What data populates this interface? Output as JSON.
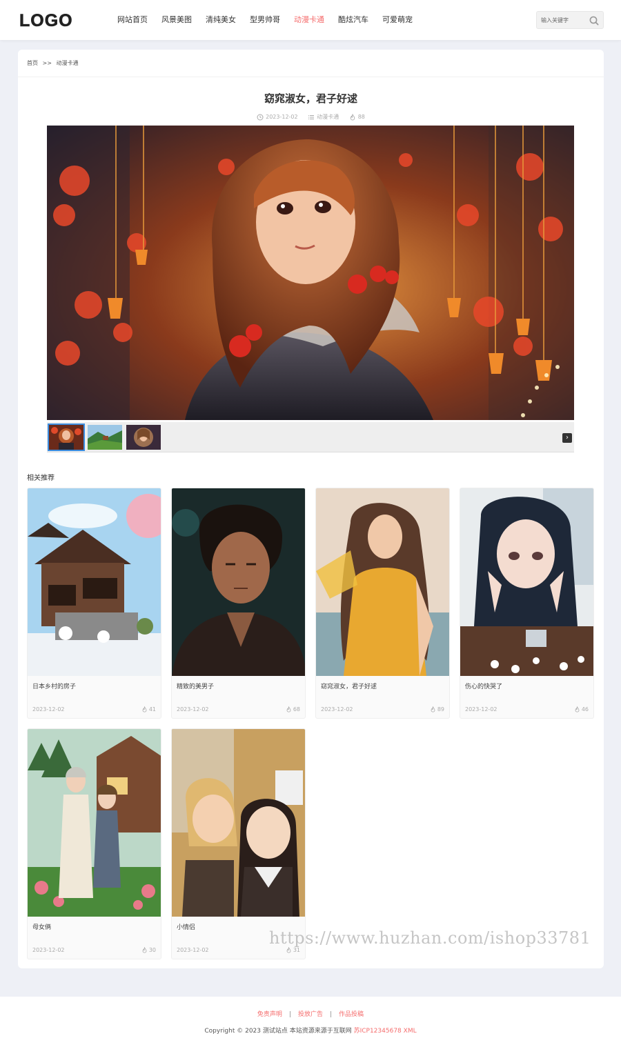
{
  "header": {
    "logo": "LOGO",
    "nav": [
      "网站首页",
      "风景美图",
      "清纯美女",
      "型男帅哥",
      "动漫卡通",
      "酷炫汽车",
      "可爱萌宠"
    ],
    "active_index": 4,
    "search_placeholder": "输入关键字",
    "accent_color": "#f56c6c"
  },
  "breadcrumb": {
    "home": "首页",
    "sep": ">>",
    "current": "动漫卡通"
  },
  "article": {
    "title": "窈窕淑女，君子好逑",
    "date": "2023-12-02",
    "category": "动漫卡通",
    "views": "88"
  },
  "related": {
    "heading": "相关推荐",
    "items": [
      {
        "name": "日本乡村的房子",
        "date": "2023-12-02",
        "views": "41"
      },
      {
        "name": "精致的美男子",
        "date": "2023-12-02",
        "views": "68"
      },
      {
        "name": "窈窕淑女，君子好逑",
        "date": "2023-12-02",
        "views": "89"
      },
      {
        "name": "伤心的快哭了",
        "date": "2023-12-02",
        "views": "46"
      },
      {
        "name": "母女俩",
        "date": "2023-12-02",
        "views": "30"
      },
      {
        "name": "小情侣",
        "date": "2023-12-02",
        "views": "31"
      }
    ]
  },
  "footer": {
    "links": [
      "免责声明",
      "投放广告",
      "作品投稿"
    ],
    "sep": "|",
    "copyright": "Copyright © 2023 测试站点 本站资源来源于互联网",
    "icp": "苏ICP12345678",
    "xml": "XML"
  },
  "watermark": "https://www.huzhan.com/ishop33781"
}
